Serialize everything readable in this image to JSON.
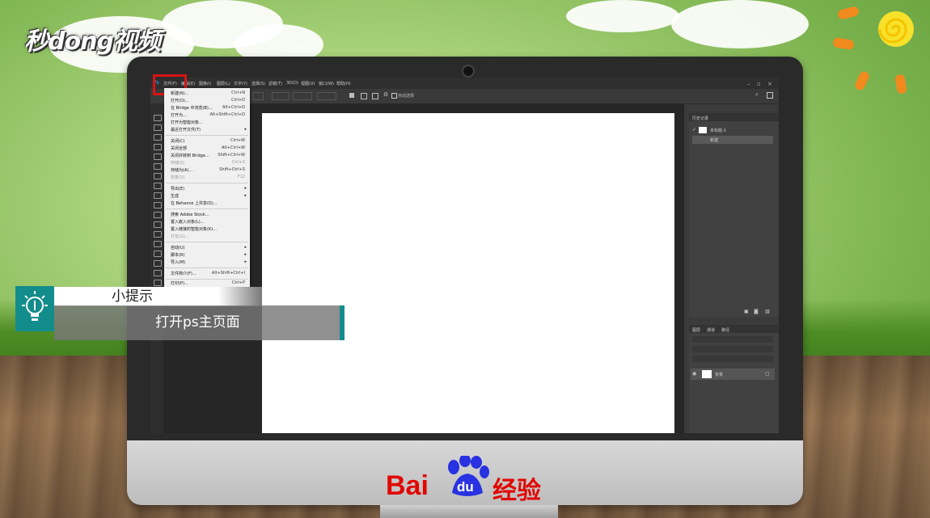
{
  "brand": {
    "logo_text": "秒dong视频"
  },
  "photoshop": {
    "menubar": [
      "文件(F)",
      "编辑(E)",
      "图像(I)",
      "图层(L)",
      "文字(Y)",
      "选择(S)",
      "滤镜(T)",
      "3D(D)",
      "视图(V)",
      "窗口(W)",
      "帮助(H)"
    ],
    "options_bar_label": "自动选择",
    "history_panel": {
      "tab": "历史记录",
      "items": [
        "未标题-1",
        "新建"
      ]
    },
    "layers_panel": {
      "tabs": [
        "图层",
        "通道",
        "路径"
      ],
      "layer_name": "背景"
    },
    "file_menu": [
      {
        "label": "新建(N)...",
        "shortcut": "Ctrl+N"
      },
      {
        "label": "打开(O)...",
        "shortcut": "Ctrl+O"
      },
      {
        "label": "在 Bridge 中浏览(B)...",
        "shortcut": "Alt+Ctrl+O"
      },
      {
        "label": "打开为...",
        "shortcut": "Alt+Shift+Ctrl+O"
      },
      {
        "label": "打开为智能对象...",
        "shortcut": ""
      },
      {
        "label": "最近打开文件(T)",
        "shortcut": ""
      },
      {
        "label": "关闭(C)",
        "shortcut": "Ctrl+W"
      },
      {
        "label": "关闭全部",
        "shortcut": "Alt+Ctrl+W"
      },
      {
        "label": "关闭并转到 Bridge...",
        "shortcut": "Shift+Ctrl+W"
      },
      {
        "label": "存储(S)",
        "shortcut": "Ctrl+S"
      },
      {
        "label": "存储为(A)...",
        "shortcut": "Shift+Ctrl+S"
      },
      {
        "label": "恢复(V)",
        "shortcut": "F12"
      },
      {
        "label": "导出(E)",
        "shortcut": ""
      },
      {
        "label": "生成",
        "shortcut": ""
      },
      {
        "label": "在 Behance 上共享(D)...",
        "shortcut": ""
      },
      {
        "label": "搜索 Adobe Stock...",
        "shortcut": ""
      },
      {
        "label": "置入嵌入对象(L)...",
        "shortcut": ""
      },
      {
        "label": "置入链接的智能对象(K)...",
        "shortcut": ""
      },
      {
        "label": "打包(G)...",
        "shortcut": ""
      },
      {
        "label": "自动(U)",
        "shortcut": ""
      },
      {
        "label": "脚本(R)",
        "shortcut": ""
      },
      {
        "label": "导入(M)",
        "shortcut": ""
      },
      {
        "label": "文件简介(F)...",
        "shortcut": "Alt+Shift+Ctrl+I"
      },
      {
        "label": "打印(P)...",
        "shortcut": "Ctrl+P"
      }
    ]
  },
  "tip": {
    "title": "小提示",
    "body": "打开ps主页面"
  },
  "footer": {
    "brand_bai": "Bai",
    "brand_du": "du",
    "brand_jingyan": "经验"
  },
  "colors": {
    "accent_teal": "#138c8c",
    "highlight_red": "#d81414",
    "baidu_red": "#e10601"
  }
}
